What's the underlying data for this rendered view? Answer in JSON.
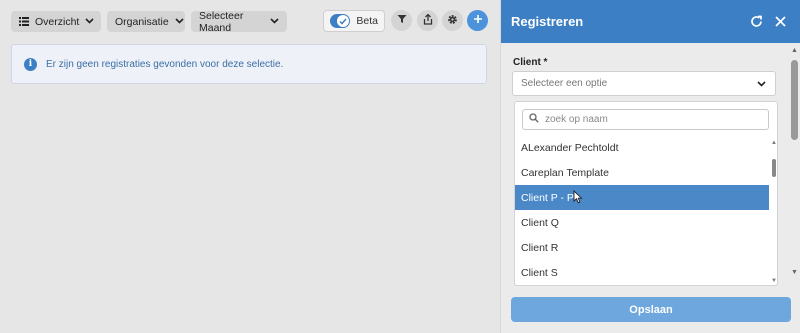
{
  "toolbar": {
    "overview_label": "Overzicht",
    "organisation_label": "Organisatie",
    "month_label": "Selecteer Maand",
    "beta_label": "Beta",
    "beta_enabled": true
  },
  "info": {
    "message": "Er zijn geen registraties gevonden voor deze selectie."
  },
  "panel": {
    "title": "Registreren",
    "client_label": "Client *",
    "select_placeholder": "Selecteer een optie",
    "search_placeholder": "zoek op naam",
    "options": [
      "ALexander Pechtoldt",
      "Careplan Template",
      "Client P - P",
      "Client Q",
      "Client R",
      "Client S"
    ],
    "selected_option": "Client P - P",
    "save_label": "Opslaan"
  },
  "colors": {
    "accent": "#3d7fc4",
    "selected_row": "#4a88c8",
    "save_button": "#6ea6de",
    "info_text": "#3b6ea5"
  },
  "icons": [
    "list-icon",
    "chevron-down-icon",
    "check-icon",
    "filter-icon",
    "share-icon",
    "gear-icon",
    "plus-icon",
    "info-icon",
    "refresh-icon",
    "close-icon",
    "search-icon",
    "mouse-pointer-icon"
  ]
}
